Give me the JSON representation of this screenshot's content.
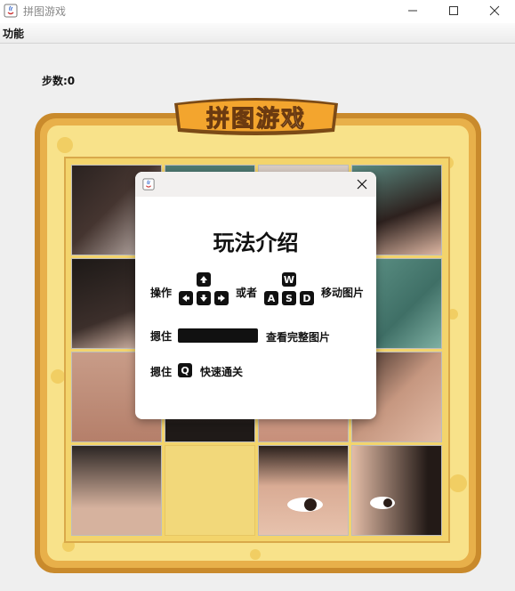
{
  "window": {
    "title": "拼图游戏"
  },
  "menu": {
    "function_label": "功能"
  },
  "status": {
    "steps_label": "步数:0"
  },
  "banner": {
    "title": "拼图游戏"
  },
  "dialog": {
    "title": "玩法介绍",
    "row1": {
      "label": "操作",
      "or": "或者",
      "action": "移动图片",
      "wasd": [
        "W",
        "A",
        "S",
        "D"
      ]
    },
    "row2": {
      "label": "摁住",
      "action": "查看完整图片"
    },
    "row3": {
      "label": "摁住",
      "key": "Q",
      "action": "快速通关"
    }
  },
  "colors": {
    "frame_wood": "#d99a35",
    "frame_board": "#f6dc7a",
    "empty_tile": "#f2d87a"
  }
}
